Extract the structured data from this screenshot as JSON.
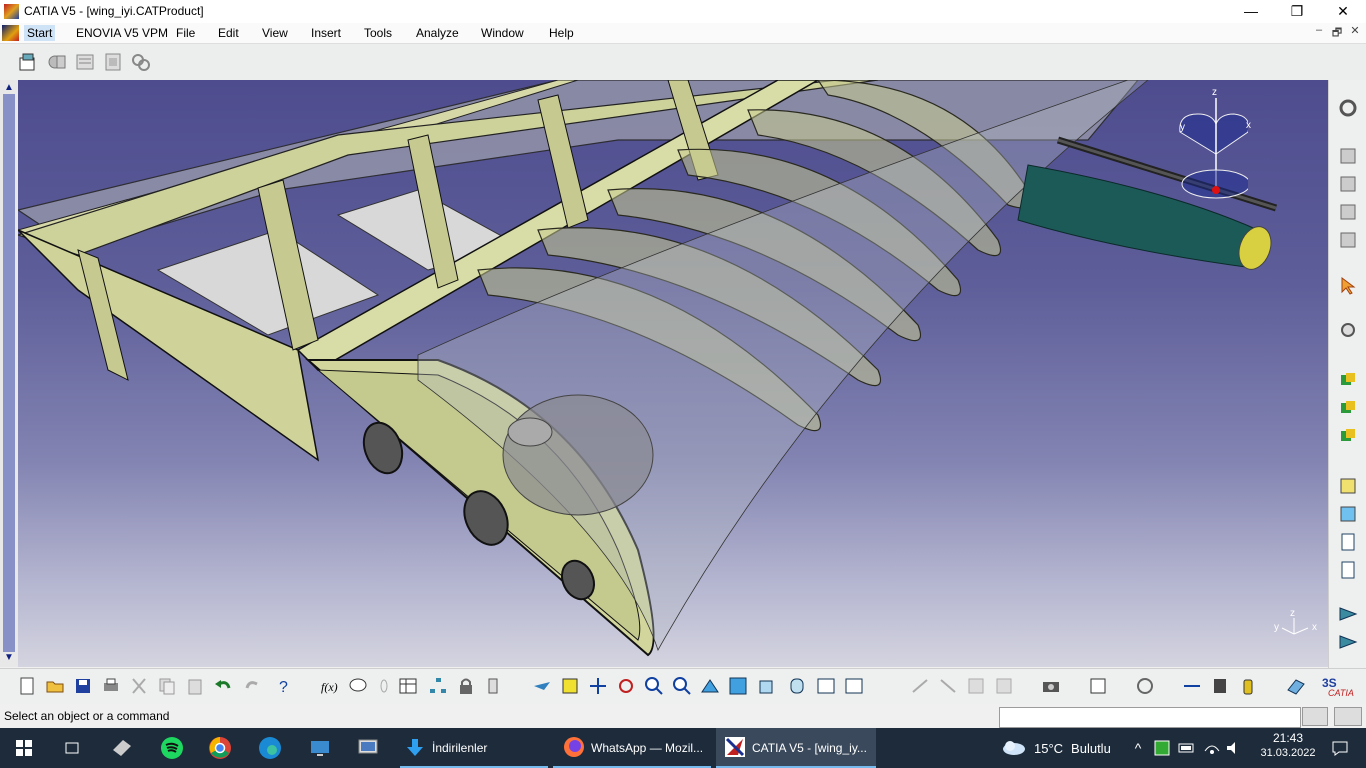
{
  "window": {
    "title": "CATIA V5 - [wing_iyi.CATProduct]",
    "controls": {
      "minimize": "—",
      "maximize": "❐",
      "close": "✕"
    }
  },
  "menubar": {
    "items": [
      "Start",
      "ENOVIA V5 VPM",
      "File",
      "Edit",
      "View",
      "Insert",
      "Tools",
      "Analyze",
      "Window",
      "Help"
    ],
    "doc_controls": {
      "minimize": "–",
      "restore": "🗗",
      "close": "✕"
    }
  },
  "viewport": {
    "compass_labels": {
      "z": "z",
      "x": "x",
      "y": "y"
    },
    "axis_labels": {
      "z": "z",
      "x": "x",
      "y": "y"
    }
  },
  "toolbars": {
    "top": [
      "select-icon",
      "part-design-icon",
      "assembly-icon",
      "sheet-icon",
      "gears-icon"
    ],
    "right": [
      "gear-settings-icon",
      "product-structure-icon",
      "components-icon",
      "insert-icon",
      "existing-icon",
      "cursor-icon",
      "manipulate-icon",
      "snap-icon",
      "move-icon",
      "explode-icon",
      "constraint-icon",
      "fix-icon",
      "coincidence-icon",
      "contact-icon",
      "offset-icon",
      "measure-icon",
      "clash-icon"
    ],
    "bottom": [
      "new-icon",
      "open-icon",
      "save-icon",
      "print-icon",
      "cut-icon",
      "copy-icon",
      "paste-icon",
      "undo-icon",
      "redo-icon",
      "whats-this-icon",
      "formula-icon",
      "comment-icon",
      "knowledge-icon",
      "table-icon",
      "tree-icon",
      "lock-icon",
      "publish-icon",
      "fly-icon",
      "fit-all-icon",
      "pan-icon",
      "rotate-icon",
      "zoom-in-icon",
      "zoom-out-icon",
      "normal-view-icon",
      "multi-view-icon",
      "iso-view-icon",
      "render-style-icon",
      "hide-show-icon",
      "swap-icon",
      "cut-plane-icon",
      "snapshot-icon",
      "bom-icon",
      "update-icon",
      "measure-between-icon",
      "inertia-icon",
      "catalog-icon",
      "scale-icon",
      "3dexperience-icon"
    ]
  },
  "statusbar": {
    "message": "Select an object or a command",
    "command_placeholder": ""
  },
  "taskbar": {
    "items": [
      {
        "icon": "windows-start-icon",
        "label": ""
      },
      {
        "icon": "task-view-icon",
        "label": ""
      },
      {
        "icon": "app-icon",
        "label": ""
      },
      {
        "icon": "spotify-icon",
        "label": ""
      },
      {
        "icon": "chrome-icon",
        "label": ""
      },
      {
        "icon": "edge-icon",
        "label": ""
      },
      {
        "icon": "remote-desktop-icon",
        "label": ""
      },
      {
        "icon": "computer-icon",
        "label": ""
      },
      {
        "icon": "download-icon",
        "label": "İndirilenler"
      },
      {
        "icon": "firefox-icon",
        "label": "WhatsApp — Mozil..."
      },
      {
        "icon": "catia-icon",
        "label": "CATIA V5 - [wing_iy..."
      }
    ],
    "weather": {
      "temp": "15°C",
      "condition": "Bulutlu"
    },
    "tray_expand": "^",
    "clock": {
      "time": "21:43",
      "date": "31.03.2022"
    }
  },
  "colors": {
    "viewport_top": "#4e4c8e",
    "viewport_bottom": "#d4d4e0",
    "wing_structure": "#cfd39a",
    "pod": "#1c5a58",
    "pod_tip": "#d8d040",
    "taskbar": "#1d2b3b"
  }
}
